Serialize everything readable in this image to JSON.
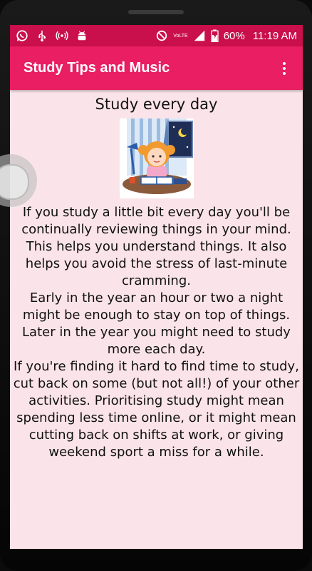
{
  "status_bar": {
    "icons_left": [
      "whatsapp-icon",
      "usb-icon",
      "hotspot-icon",
      "android-debug-icon"
    ],
    "icons_right": [
      "no-disturb-icon",
      "volte-icon",
      "signal-icon",
      "battery-icon"
    ],
    "volte_label": "VoLTE",
    "battery": "60%",
    "time": "11:19 AM"
  },
  "app_bar": {
    "title": "Study Tips and Music",
    "menu_icon": "more-vert-icon"
  },
  "content": {
    "heading": "Study every day",
    "image_icon": "girl-studying-illustration",
    "paragraphs": [
      "If you study a little bit every day you'll be continually reviewing things in your mind. This helps you understand things. It also helps you avoid the stress of last-minute cramming.",
      "Early in the year an hour or two a night might be enough to stay on top of things. Later in the year you might need to study more each day.",
      "If you're finding it hard to find time to study, cut back on some (but not all!) of your other activities. Prioritising study might mean spending less time online, or it might mean cutting back on shifts at work, or giving weekend sport a miss for a while."
    ]
  },
  "colors": {
    "status_bar": "#c90f4c",
    "app_bar": "#e91e63",
    "background": "#fbe4e9"
  }
}
